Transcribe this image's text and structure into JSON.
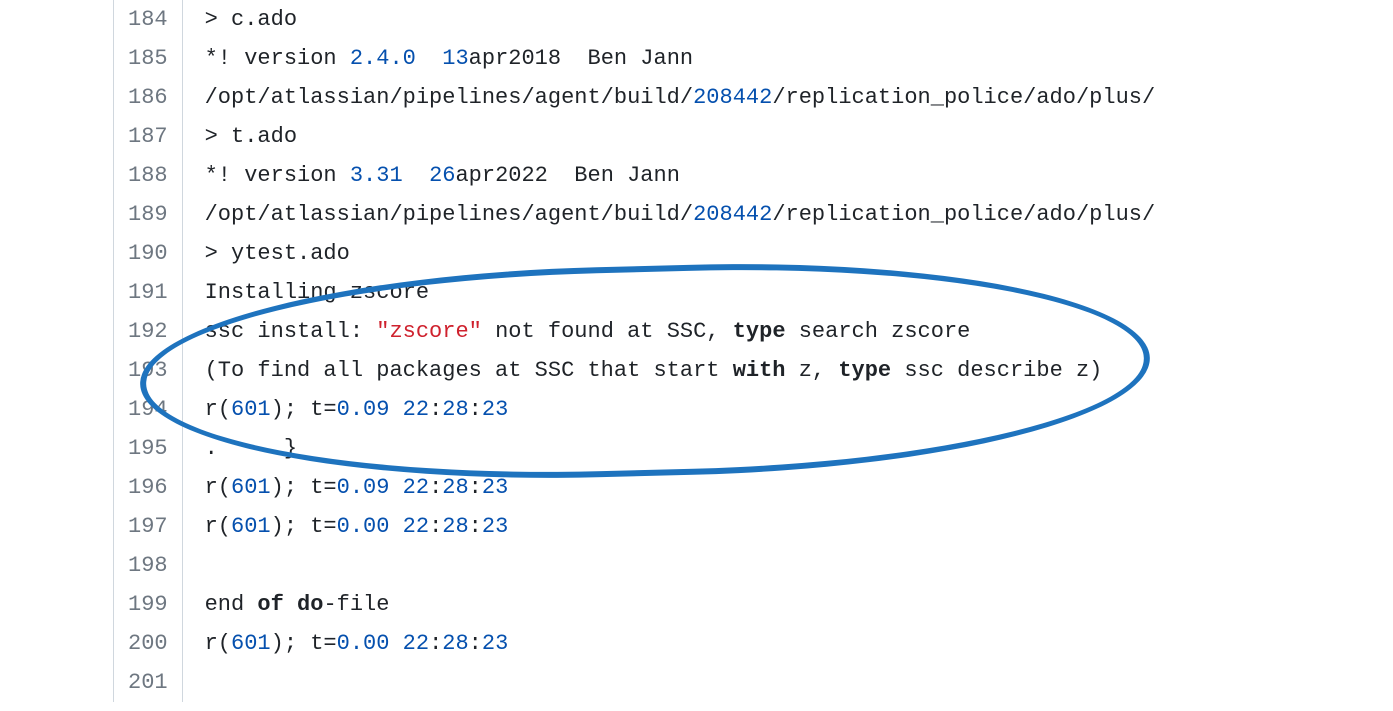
{
  "lines": [
    {
      "num": "184",
      "segments": [
        {
          "t": "> c.ado",
          "c": ""
        }
      ]
    },
    {
      "num": "185",
      "segments": [
        {
          "t": "*! version ",
          "c": ""
        },
        {
          "t": "2.4.0",
          "c": "tok-num"
        },
        {
          "t": "  ",
          "c": ""
        },
        {
          "t": "13",
          "c": "tok-num"
        },
        {
          "t": "apr2018  Ben Jann",
          "c": ""
        }
      ]
    },
    {
      "num": "186",
      "segments": [
        {
          "t": "/opt/atlassian/pipelines/agent/build/",
          "c": "tok-path"
        },
        {
          "t": "208442",
          "c": "tok-num"
        },
        {
          "t": "/replication_police/ado/plus/",
          "c": "tok-path"
        }
      ]
    },
    {
      "num": "187",
      "segments": [
        {
          "t": "> t.ado",
          "c": ""
        }
      ]
    },
    {
      "num": "188",
      "segments": [
        {
          "t": "*! version ",
          "c": ""
        },
        {
          "t": "3.31",
          "c": "tok-num"
        },
        {
          "t": "  ",
          "c": ""
        },
        {
          "t": "26",
          "c": "tok-num"
        },
        {
          "t": "apr2022  Ben Jann",
          "c": ""
        }
      ]
    },
    {
      "num": "189",
      "segments": [
        {
          "t": "/opt/atlassian/pipelines/agent/build/",
          "c": "tok-path"
        },
        {
          "t": "208442",
          "c": "tok-num"
        },
        {
          "t": "/replication_police/ado/plus/",
          "c": "tok-path"
        }
      ]
    },
    {
      "num": "190",
      "segments": [
        {
          "t": "> ytest.ado",
          "c": ""
        }
      ]
    },
    {
      "num": "191",
      "segments": [
        {
          "t": "Installing zscore",
          "c": ""
        }
      ]
    },
    {
      "num": "192",
      "segments": [
        {
          "t": "ssc install: ",
          "c": ""
        },
        {
          "t": "\"zscore\"",
          "c": "tok-str"
        },
        {
          "t": " not found at SSC, ",
          "c": ""
        },
        {
          "t": "type",
          "c": "tok-kw"
        },
        {
          "t": " search zscore",
          "c": ""
        }
      ]
    },
    {
      "num": "193",
      "segments": [
        {
          "t": "(To find all packages at SSC that start ",
          "c": ""
        },
        {
          "t": "with",
          "c": "tok-kw"
        },
        {
          "t": " z, ",
          "c": ""
        },
        {
          "t": "type",
          "c": "tok-kw"
        },
        {
          "t": " ssc describe z)",
          "c": ""
        }
      ]
    },
    {
      "num": "194",
      "segments": [
        {
          "t": "r(",
          "c": ""
        },
        {
          "t": "601",
          "c": "tok-num"
        },
        {
          "t": "); t=",
          "c": ""
        },
        {
          "t": "0.09",
          "c": "tok-num"
        },
        {
          "t": " ",
          "c": ""
        },
        {
          "t": "22",
          "c": "tok-num"
        },
        {
          "t": ":",
          "c": ""
        },
        {
          "t": "28",
          "c": "tok-num"
        },
        {
          "t": ":",
          "c": ""
        },
        {
          "t": "23",
          "c": "tok-num"
        }
      ]
    },
    {
      "num": "195",
      "segments": [
        {
          "t": ".     }",
          "c": ""
        }
      ]
    },
    {
      "num": "196",
      "segments": [
        {
          "t": "r(",
          "c": ""
        },
        {
          "t": "601",
          "c": "tok-num"
        },
        {
          "t": "); t=",
          "c": ""
        },
        {
          "t": "0.09",
          "c": "tok-num"
        },
        {
          "t": " ",
          "c": ""
        },
        {
          "t": "22",
          "c": "tok-num"
        },
        {
          "t": ":",
          "c": ""
        },
        {
          "t": "28",
          "c": "tok-num"
        },
        {
          "t": ":",
          "c": ""
        },
        {
          "t": "23",
          "c": "tok-num"
        }
      ]
    },
    {
      "num": "197",
      "segments": [
        {
          "t": "r(",
          "c": ""
        },
        {
          "t": "601",
          "c": "tok-num"
        },
        {
          "t": "); t=",
          "c": ""
        },
        {
          "t": "0.00",
          "c": "tok-num"
        },
        {
          "t": " ",
          "c": ""
        },
        {
          "t": "22",
          "c": "tok-num"
        },
        {
          "t": ":",
          "c": ""
        },
        {
          "t": "28",
          "c": "tok-num"
        },
        {
          "t": ":",
          "c": ""
        },
        {
          "t": "23",
          "c": "tok-num"
        }
      ]
    },
    {
      "num": "198",
      "segments": [
        {
          "t": "",
          "c": ""
        }
      ]
    },
    {
      "num": "199",
      "segments": [
        {
          "t": "end ",
          "c": ""
        },
        {
          "t": "of",
          "c": "tok-kw"
        },
        {
          "t": " ",
          "c": ""
        },
        {
          "t": "do",
          "c": "tok-kw"
        },
        {
          "t": "-file",
          "c": ""
        }
      ]
    },
    {
      "num": "200",
      "segments": [
        {
          "t": "r(",
          "c": ""
        },
        {
          "t": "601",
          "c": "tok-num"
        },
        {
          "t": "); t=",
          "c": ""
        },
        {
          "t": "0.00",
          "c": "tok-num"
        },
        {
          "t": " ",
          "c": ""
        },
        {
          "t": "22",
          "c": "tok-num"
        },
        {
          "t": ":",
          "c": ""
        },
        {
          "t": "28",
          "c": "tok-num"
        },
        {
          "t": ":",
          "c": ""
        },
        {
          "t": "23",
          "c": "tok-num"
        }
      ]
    },
    {
      "num": "201",
      "segments": [
        {
          "t": "",
          "c": ""
        }
      ]
    }
  ]
}
